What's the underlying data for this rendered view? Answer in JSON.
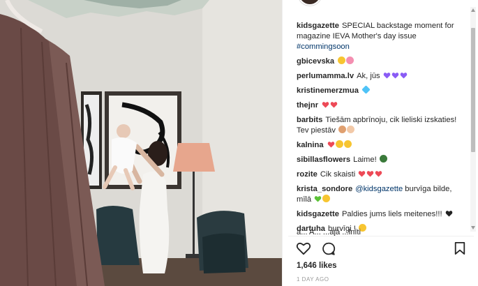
{
  "post": {
    "caption_user": "kidsgazette",
    "caption_text": "SPECIAL backstage moment for magazine IEVA Mother's day issue",
    "caption_hashtag": "#commingsoon"
  },
  "comments": [
    {
      "user": "gbicevska",
      "text": "",
      "emojis": [
        "face-hearteyes",
        "flower"
      ]
    },
    {
      "user": "perlumamma.lv",
      "text": "Ak, jūs",
      "emojis": [
        "purple-heart",
        "purple-heart",
        "purple-heart"
      ]
    },
    {
      "user": "kristinemerzmua",
      "text": "",
      "emojis": [
        "diamond"
      ]
    },
    {
      "user": "thejnr",
      "text": "",
      "emojis": [
        "red-heart",
        "red-heart"
      ]
    },
    {
      "user": "barbits",
      "text": "Tiešām apbrīnoju, cik lieliski izskaties! Tev piestāv",
      "emojis": [
        "baby-bottle",
        "baby"
      ]
    },
    {
      "user": "kalnina",
      "text": "",
      "emojis": [
        "red-heart",
        "face-smile",
        "face-hearteyes"
      ]
    },
    {
      "user": "sibillasflowers",
      "text": "Laime!",
      "emojis": [
        "sunglasses-face"
      ]
    },
    {
      "user": "rozite",
      "text": "Cik skaisti",
      "emojis": [
        "red-heart",
        "red-heart",
        "red-heart"
      ]
    },
    {
      "user": "krista_sondore",
      "mention": "@kidsgazette",
      "text": "burvīga bilde, mīlā",
      "emojis": [
        "green-heart",
        "sun"
      ]
    },
    {
      "user": "kidsgazette",
      "text": "Paldies jums liels meitenes!!!",
      "emojis": [
        "black-heart"
      ]
    },
    {
      "user": "dartuha",
      "text": "burvīgi !",
      "emojis": [
        "smile-yellow"
      ]
    }
  ],
  "partial_comment": "a... A... ...ajā ...lnīti",
  "likes": "1,646 likes",
  "time": "1 DAY AGO",
  "colors": {
    "red": "#ed4956",
    "purple": "#8a5cf5",
    "link": "#003569",
    "green": "#5bc236",
    "yellow": "#f7c531"
  },
  "icons": {
    "like": "heart-outline-icon",
    "comment": "comment-bubble-icon",
    "save": "bookmark-icon"
  }
}
